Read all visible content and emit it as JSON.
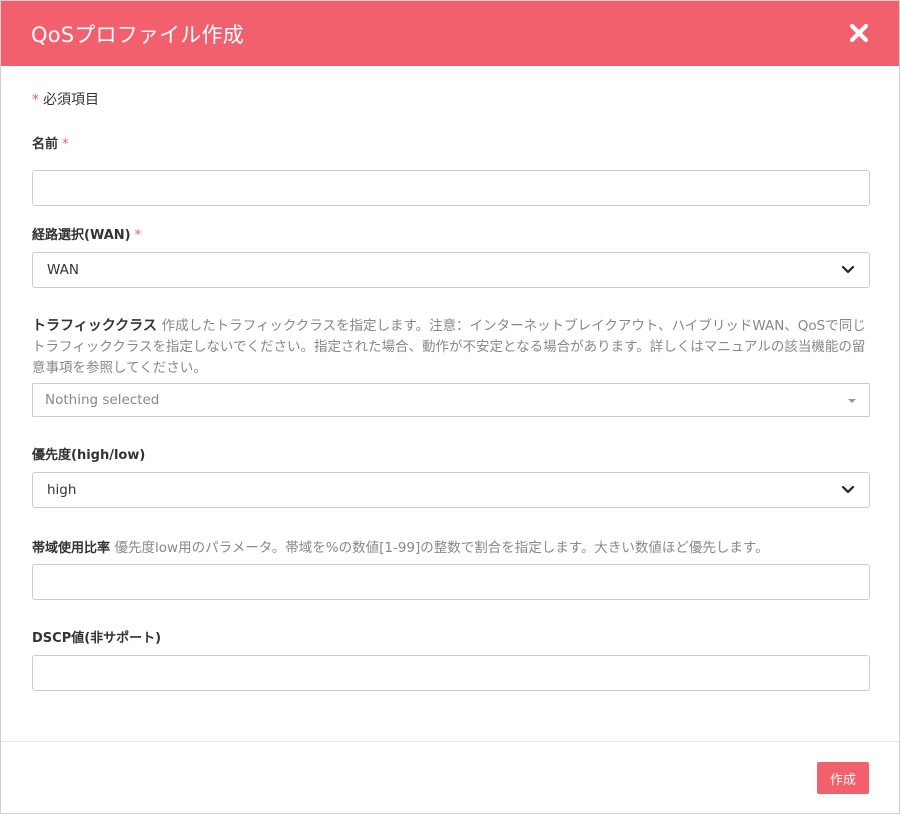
{
  "modal": {
    "title": "QoSプロファイル作成",
    "close_icon": "close-icon"
  },
  "required_note": {
    "mark": "*",
    "text": "必須項目"
  },
  "fields": {
    "name": {
      "label": "名前",
      "required_mark": "*",
      "value": ""
    },
    "route": {
      "label": "経路選択(WAN)",
      "required_mark": "*",
      "selected": "WAN"
    },
    "traffic_class": {
      "label": "トラフィッククラス",
      "help": "作成したトラフィッククラスを指定します。注意：インターネットブレイクアウト、ハイブリッドWAN、QoSで同じトラフィッククラスを指定しないでください。指定された場合、動作が不安定となる場合があります。詳しくはマニュアルの該当機能の留意事項を参照してください。",
      "placeholder": "Nothing selected"
    },
    "priority": {
      "label": "優先度(high/low)",
      "selected": "high"
    },
    "bandwidth": {
      "label": "帯域使用比率",
      "help": "優先度low用のパラメータ。帯域を%の数値[1-99]の整数で割合を指定します。大きい数値ほど優先します。",
      "value": ""
    },
    "dscp": {
      "label": "DSCP値(非サポート)",
      "value": ""
    }
  },
  "footer": {
    "submit_label": "作成"
  },
  "colors": {
    "accent": "#f25f6d",
    "required": "#e85a64",
    "help_text": "#888888"
  }
}
